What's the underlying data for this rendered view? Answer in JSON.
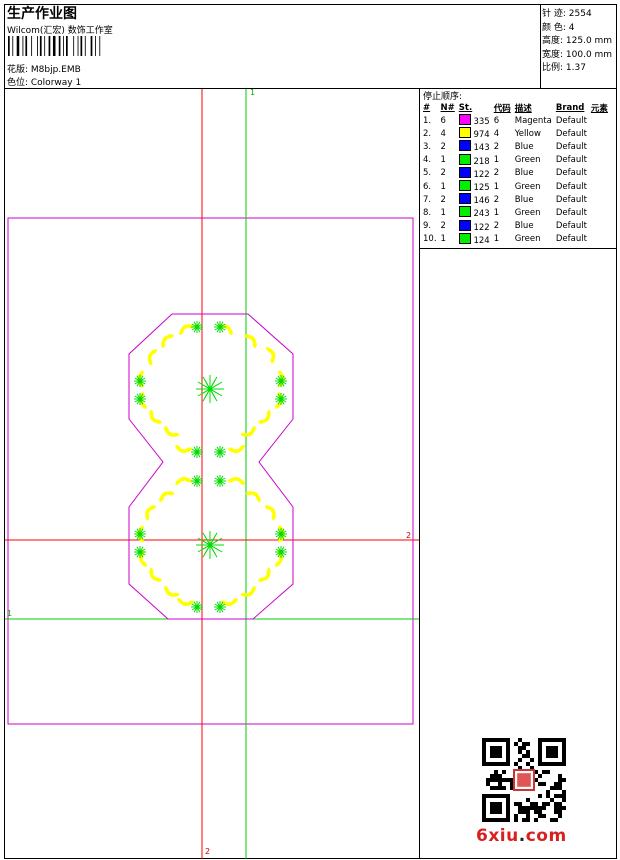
{
  "header": {
    "title": "生产作业图",
    "company": "Wilcom(汇宏) 数饰工作室",
    "design_label": "花版: M8bjp.EMB",
    "colorway_label": "色位: Colorway 1"
  },
  "stats": [
    {
      "label": "针 迹:",
      "value": "2554"
    },
    {
      "label": "颜 色:",
      "value": "4"
    },
    {
      "label": "高度:",
      "value": "125.0 mm"
    },
    {
      "label": "宽度:",
      "value": "100.0 mm"
    },
    {
      "label": "比例:",
      "value": "1.37"
    }
  ],
  "sequence": {
    "title": "停止顺序:",
    "headers": [
      "#",
      "N#",
      "St.",
      "代码",
      "描述",
      "Brand",
      "元素"
    ],
    "rows": [
      {
        "idx": "1.",
        "n": "6",
        "color": "#ff00ff",
        "code": "335",
        "st": "6",
        "desc": "Magenta",
        "brand": "Default"
      },
      {
        "idx": "2.",
        "n": "4",
        "color": "#ffff00",
        "code": "974",
        "st": "4",
        "desc": "Yellow",
        "brand": "Default"
      },
      {
        "idx": "3.",
        "n": "2",
        "color": "#0000ff",
        "code": "143",
        "st": "2",
        "desc": "Blue",
        "brand": "Default"
      },
      {
        "idx": "4.",
        "n": "1",
        "color": "#00ee00",
        "code": "218",
        "st": "1",
        "desc": "Green",
        "brand": "Default"
      },
      {
        "idx": "5.",
        "n": "2",
        "color": "#0000ff",
        "code": "122",
        "st": "2",
        "desc": "Blue",
        "brand": "Default"
      },
      {
        "idx": "6.",
        "n": "1",
        "color": "#00ee00",
        "code": "125",
        "st": "1",
        "desc": "Green",
        "brand": "Default"
      },
      {
        "idx": "7.",
        "n": "2",
        "color": "#0000ff",
        "code": "146",
        "st": "2",
        "desc": "Blue",
        "brand": "Default"
      },
      {
        "idx": "8.",
        "n": "1",
        "color": "#00ee00",
        "code": "243",
        "st": "1",
        "desc": "Green",
        "brand": "Default"
      },
      {
        "idx": "9.",
        "n": "2",
        "color": "#0000ff",
        "code": "122",
        "st": "2",
        "desc": "Blue",
        "brand": "Default"
      },
      {
        "idx": "10.",
        "n": "1",
        "color": "#00ee00",
        "code": "124",
        "st": "1",
        "desc": "Green",
        "brand": "Default"
      }
    ]
  },
  "canvas": {
    "axis_labels": {
      "top_green": "1",
      "right_red": "2",
      "left_green": "1",
      "bottom_red": "2"
    },
    "colors": {
      "hoop": "#cc00cc",
      "outline": "#cc00cc",
      "leaf": "#ffff00",
      "star": "#00dd00",
      "guide_red": "#ff0000",
      "guide_green": "#00cc00"
    }
  },
  "watermark": {
    "logo_main": "6xiu",
    "logo_dot": ".",
    "logo_tail": "com"
  }
}
